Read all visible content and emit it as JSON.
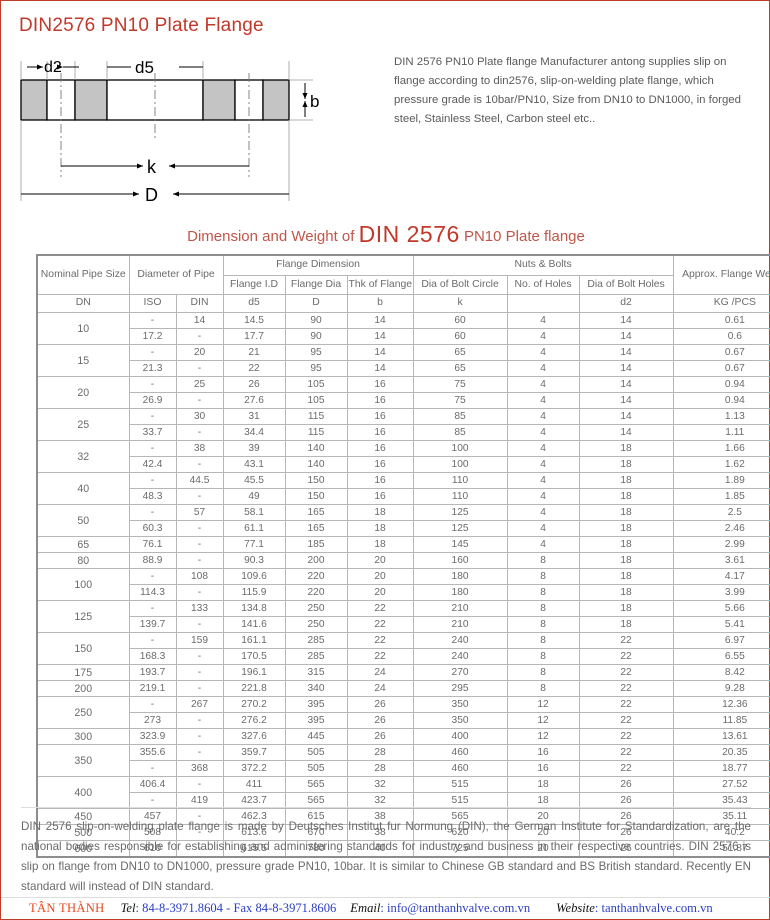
{
  "title": "DIN2576 PN10 Plate Flange",
  "description": "DIN 2576 PN10 Plate flange Manufacturer antong supplies slip on flange according to din2576, slip-on-welding plate flange, which pressure grade is 10bar/PN10, Size from DN10 to DN1000, in forged steel, Stainless Steel, Carbon steel etc..",
  "diagram": {
    "labels": {
      "d2": "d2",
      "d5": "d5",
      "b": "b",
      "k": "k",
      "D": "D"
    }
  },
  "sub_heading": {
    "lead": "Dimension and Weight of ",
    "standard": "DIN 2576",
    "tail": " PN10 Plate flange"
  },
  "table": {
    "group_headers": {
      "nominal_pipe_size": "Nominal Pipe Size",
      "diameter_of_pipe": "Diameter of Pipe",
      "flange_dimension": "Flange Dimension",
      "nuts_and_bolts": "Nuts & Bolts",
      "approx_flange_weight": "Approx. Flange Weight"
    },
    "sub_headers": {
      "flange_id": "Flange I.D",
      "flange_dia": "Flange Dia",
      "thk_of_flange": "Thk of Flange",
      "dia_of_bolt_circle": "Dia of Bolt Circle",
      "no_of_holes": "No. of Holes",
      "dia_of_bolt_holes": "Dia of Bolt Holes"
    },
    "symbols": {
      "dn": "DN",
      "iso": "ISO",
      "din": "DIN",
      "d5": "d5",
      "D": "D",
      "b": "b",
      "k": "k",
      "holes": "",
      "d2": "d2",
      "weight": "KG /PCS"
    },
    "rows": [
      {
        "dn": "10",
        "span": 2,
        "lines": [
          {
            "iso": "-",
            "din": "14",
            "d5": "14.5",
            "D": "90",
            "b": "14",
            "k": "60",
            "holes": "4",
            "d2": "14",
            "weight": "0.61"
          },
          {
            "iso": "17.2",
            "din": "-",
            "d5": "17.7",
            "D": "90",
            "b": "14",
            "k": "60",
            "holes": "4",
            "d2": "14",
            "weight": "0.6"
          }
        ]
      },
      {
        "dn": "15",
        "span": 2,
        "lines": [
          {
            "iso": "-",
            "din": "20",
            "d5": "21",
            "D": "95",
            "b": "14",
            "k": "65",
            "holes": "4",
            "d2": "14",
            "weight": "0.67"
          },
          {
            "iso": "21.3",
            "din": "-",
            "d5": "22",
            "D": "95",
            "b": "14",
            "k": "65",
            "holes": "4",
            "d2": "14",
            "weight": "0.67"
          }
        ]
      },
      {
        "dn": "20",
        "span": 2,
        "lines": [
          {
            "iso": "-",
            "din": "25",
            "d5": "26",
            "D": "105",
            "b": "16",
            "k": "75",
            "holes": "4",
            "d2": "14",
            "weight": "0.94"
          },
          {
            "iso": "26.9",
            "din": "-",
            "d5": "27.6",
            "D": "105",
            "b": "16",
            "k": "75",
            "holes": "4",
            "d2": "14",
            "weight": "0.94"
          }
        ]
      },
      {
        "dn": "25",
        "span": 2,
        "lines": [
          {
            "iso": "-",
            "din": "30",
            "d5": "31",
            "D": "115",
            "b": "16",
            "k": "85",
            "holes": "4",
            "d2": "14",
            "weight": "1.13"
          },
          {
            "iso": "33.7",
            "din": "-",
            "d5": "34.4",
            "D": "115",
            "b": "16",
            "k": "85",
            "holes": "4",
            "d2": "14",
            "weight": "1.11"
          }
        ]
      },
      {
        "dn": "32",
        "span": 2,
        "lines": [
          {
            "iso": "-",
            "din": "38",
            "d5": "39",
            "D": "140",
            "b": "16",
            "k": "100",
            "holes": "4",
            "d2": "18",
            "weight": "1.66"
          },
          {
            "iso": "42.4",
            "din": "-",
            "d5": "43.1",
            "D": "140",
            "b": "16",
            "k": "100",
            "holes": "4",
            "d2": "18",
            "weight": "1.62"
          }
        ]
      },
      {
        "dn": "40",
        "span": 2,
        "lines": [
          {
            "iso": "-",
            "din": "44.5",
            "d5": "45.5",
            "D": "150",
            "b": "16",
            "k": "110",
            "holes": "4",
            "d2": "18",
            "weight": "1.89"
          },
          {
            "iso": "48.3",
            "din": "-",
            "d5": "49",
            "D": "150",
            "b": "16",
            "k": "110",
            "holes": "4",
            "d2": "18",
            "weight": "1.85"
          }
        ]
      },
      {
        "dn": "50",
        "span": 2,
        "lines": [
          {
            "iso": "-",
            "din": "57",
            "d5": "58.1",
            "D": "165",
            "b": "18",
            "k": "125",
            "holes": "4",
            "d2": "18",
            "weight": "2.5"
          },
          {
            "iso": "60.3",
            "din": "-",
            "d5": "61.1",
            "D": "165",
            "b": "18",
            "k": "125",
            "holes": "4",
            "d2": "18",
            "weight": "2.46"
          }
        ]
      },
      {
        "dn": "65",
        "span": 1,
        "lines": [
          {
            "iso": "76.1",
            "din": "-",
            "d5": "77.1",
            "D": "185",
            "b": "18",
            "k": "145",
            "holes": "4",
            "d2": "18",
            "weight": "2.99"
          }
        ]
      },
      {
        "dn": "80",
        "span": 1,
        "lines": [
          {
            "iso": "88.9",
            "din": "-",
            "d5": "90.3",
            "D": "200",
            "b": "20",
            "k": "160",
            "holes": "8",
            "d2": "18",
            "weight": "3.61"
          }
        ]
      },
      {
        "dn": "100",
        "span": 2,
        "lines": [
          {
            "iso": "-",
            "din": "108",
            "d5": "109.6",
            "D": "220",
            "b": "20",
            "k": "180",
            "holes": "8",
            "d2": "18",
            "weight": "4.17"
          },
          {
            "iso": "114.3",
            "din": "-",
            "d5": "115.9",
            "D": "220",
            "b": "20",
            "k": "180",
            "holes": "8",
            "d2": "18",
            "weight": "3.99"
          }
        ]
      },
      {
        "dn": "125",
        "span": 2,
        "lines": [
          {
            "iso": "-",
            "din": "133",
            "d5": "134.8",
            "D": "250",
            "b": "22",
            "k": "210",
            "holes": "8",
            "d2": "18",
            "weight": "5.66"
          },
          {
            "iso": "139.7",
            "din": "-",
            "d5": "141.6",
            "D": "250",
            "b": "22",
            "k": "210",
            "holes": "8",
            "d2": "18",
            "weight": "5.41"
          }
        ]
      },
      {
        "dn": "150",
        "span": 2,
        "lines": [
          {
            "iso": "-",
            "din": "159",
            "d5": "161.1",
            "D": "285",
            "b": "22",
            "k": "240",
            "holes": "8",
            "d2": "22",
            "weight": "6.97"
          },
          {
            "iso": "168.3",
            "din": "-",
            "d5": "170.5",
            "D": "285",
            "b": "22",
            "k": "240",
            "holes": "8",
            "d2": "22",
            "weight": "6.55"
          }
        ]
      },
      {
        "dn": "175",
        "span": 1,
        "lines": [
          {
            "iso": "193.7",
            "din": "-",
            "d5": "196.1",
            "D": "315",
            "b": "24",
            "k": "270",
            "holes": "8",
            "d2": "22",
            "weight": "8.42"
          }
        ]
      },
      {
        "dn": "200",
        "span": 1,
        "lines": [
          {
            "iso": "219.1",
            "din": "-",
            "d5": "221.8",
            "D": "340",
            "b": "24",
            "k": "295",
            "holes": "8",
            "d2": "22",
            "weight": "9.28"
          }
        ]
      },
      {
        "dn": "250",
        "span": 2,
        "lines": [
          {
            "iso": "-",
            "din": "267",
            "d5": "270.2",
            "D": "395",
            "b": "26",
            "k": "350",
            "holes": "12",
            "d2": "22",
            "weight": "12.36"
          },
          {
            "iso": "273",
            "din": "-",
            "d5": "276.2",
            "D": "395",
            "b": "26",
            "k": "350",
            "holes": "12",
            "d2": "22",
            "weight": "11.85"
          }
        ]
      },
      {
        "dn": "300",
        "span": 1,
        "lines": [
          {
            "iso": "323.9",
            "din": "-",
            "d5": "327.6",
            "D": "445",
            "b": "26",
            "k": "400",
            "holes": "12",
            "d2": "22",
            "weight": "13.61"
          }
        ]
      },
      {
        "dn": "350",
        "span": 2,
        "lines": [
          {
            "iso": "355.6",
            "din": "-",
            "d5": "359.7",
            "D": "505",
            "b": "28",
            "k": "460",
            "holes": "16",
            "d2": "22",
            "weight": "20.35"
          },
          {
            "iso": "-",
            "din": "368",
            "d5": "372.2",
            "D": "505",
            "b": "28",
            "k": "460",
            "holes": "16",
            "d2": "22",
            "weight": "18.77"
          }
        ]
      },
      {
        "dn": "400",
        "span": 2,
        "lines": [
          {
            "iso": "406.4",
            "din": "-",
            "d5": "411",
            "D": "565",
            "b": "32",
            "k": "515",
            "holes": "18",
            "d2": "26",
            "weight": "27.52"
          },
          {
            "iso": "-",
            "din": "419",
            "d5": "423.7",
            "D": "565",
            "b": "32",
            "k": "515",
            "holes": "18",
            "d2": "26",
            "weight": "35.43"
          }
        ]
      },
      {
        "dn": "450",
        "span": 1,
        "lines": [
          {
            "iso": "457",
            "din": "-",
            "d5": "462.3",
            "D": "615",
            "b": "38",
            "k": "565",
            "holes": "20",
            "d2": "26",
            "weight": "35.11"
          }
        ]
      },
      {
        "dn": "500",
        "span": 1,
        "lines": [
          {
            "iso": "508",
            "din": "-",
            "d5": "613.6",
            "D": "670",
            "b": "38",
            "k": "620",
            "holes": "20",
            "d2": "26",
            "weight": "40.2"
          }
        ]
      },
      {
        "dn": "600",
        "span": 1,
        "lines": [
          {
            "iso": "610",
            "din": "-",
            "d5": "615.5",
            "D": "780",
            "b": "40",
            "k": "725",
            "holes": "20",
            "d2": "26",
            "weight": "51.87"
          }
        ]
      }
    ]
  },
  "footer_note": "DIN 2576 slip-on-welding plate flange is made by Deutsches Institut fur Normung (DIN), the German Institute for Standardization, are the national bodies responsible for establishing and administering standards for industry and business in their respective countries. DIN 2576 is slip on flange from DN10 to DN1000, pressure grade PN10, 10bar. It is similar to Chinese GB standard and BS British standard. Recently EN standard will instead of DIN standard.",
  "contact": {
    "brand": "TÂN THÀNH",
    "tel_label": "Tel",
    "tel_value": ": 84-8-3971.8604 - Fax 84-8-3971.8606",
    "email_label": "Email",
    "email_value": ": info@tanthanhvalve.com.vn",
    "website_label": "Website",
    "website_value": ": tanthanhvalve.com.vn"
  },
  "colors": {
    "brand_red": "#c0392b",
    "contact_orange": "#e8491d",
    "link_blue": "#2b3ec4",
    "table_border": "#b7b7b7",
    "text_gray": "#6b6b6b"
  }
}
